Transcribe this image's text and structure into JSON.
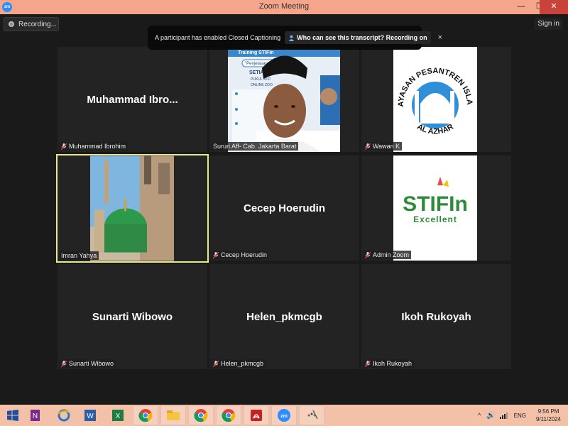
{
  "window": {
    "title": "Zoom Meeting"
  },
  "topbar": {
    "recording_label": "Recording...",
    "signin_label": "Sign in"
  },
  "cc_banner": {
    "text": "A participant has enabled Closed Captioning",
    "link": "Who can see this transcript? Recording on",
    "close": "×"
  },
  "tiles": [
    {
      "display_name": "Muhammad  Ibro...",
      "label": "Muhammad Ibrohim",
      "muted": true
    },
    {
      "display_name": "",
      "label": "Sururi Aff- Cab. Jakarta Barat",
      "muted": false,
      "video": true
    },
    {
      "display_name": "",
      "label": "Wawan K",
      "muted": true,
      "video": true
    },
    {
      "display_name": "",
      "label": "Imran Yahya",
      "muted": false,
      "video": true,
      "active": true
    },
    {
      "display_name": "Cecep Hoerudin",
      "label": "Cecep Hoerudin",
      "muted": true
    },
    {
      "display_name": "",
      "label": "Admin Zoom",
      "muted": true,
      "video": true
    },
    {
      "display_name": "Sunarti Wibowo",
      "label": "Sunarti Wibowo",
      "muted": true
    },
    {
      "display_name": "Helen_pkmcgb",
      "label": "Helen_pkmcgb",
      "muted": true
    },
    {
      "display_name": "Ikoh Rukoyah",
      "label": "Ikoh Rukoyah",
      "muted": true
    }
  ],
  "logo_yayasan": {
    "arc_top": "YAYASAN PESANTREN ISLAM",
    "arc_bottom": "AL AZHAR"
  },
  "logo_stifin": {
    "main": "STIFIn",
    "sub": "Excellent"
  },
  "slide_text": {
    "banner": "Training STIFIn",
    "sub": "\"Penjelasan I",
    "setiap": "SETIAP S",
    "pukul": "PUKUL 20.0",
    "online": "ONLINE ZOO"
  },
  "taskbar": {
    "apps": [
      "windows-start",
      "onenote",
      "internet-explorer",
      "word",
      "excel",
      "chrome",
      "file-explorer",
      "chrome",
      "chrome",
      "acrobat",
      "zoom",
      "paint"
    ],
    "lang": "ENG",
    "time": "9:56 PM",
    "date": "9/11/2024"
  },
  "colors": {
    "titlebar": "#f4a58a",
    "taskbar": "#f2c1a8",
    "active_border": "#e8ea8a",
    "tile_bg": "#232323"
  }
}
